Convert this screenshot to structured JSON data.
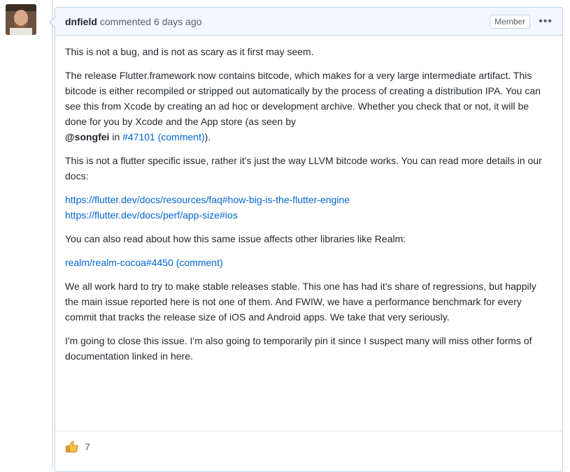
{
  "comment": {
    "author": "dnfield",
    "action": "commented",
    "time": "6 days ago",
    "badge": "Member",
    "menu_icon": "kebab-icon",
    "paragraphs": {
      "p1": "This is not a bug, and is not as scary as it first may seem.",
      "p2": "The release Flutter.framework now contains bitcode, which makes for a very large intermediate artifact. This bitcode is either recompiled or stripped out automatically by the process of creating a distribution IPA. You can see this from Xcode by creating an ad hoc or development archive. Whether you check that or not, it will be done for you by Xcode and the App store (as seen by",
      "p2_mention": "@songfei",
      "p2_in": " in ",
      "p2_link": "#47101 (comment)",
      "p2_end": ").",
      "p3": "This is not a flutter specific issue, rather it's just the way LLVM bitcode works. You can read more details in our docs:",
      "link1": "https://flutter.dev/docs/resources/faq#how-big-is-the-flutter-engine",
      "link2": "https://flutter.dev/docs/perf/app-size#ios",
      "p4": "You can also read about how this same issue affects other libraries like Realm:",
      "link3": "realm/realm-cocoa#4450 (comment)",
      "p5": "We all work hard to try to make stable releases stable. This one has had it's share of regressions, but happily the main issue reported here is not one of them. And FWIW, we have a performance benchmark for every commit that tracks the release size of iOS and Android apps. We take that very seriously.",
      "p6": "I'm going to close this issue. I'm also going to temporarily pin it since I suspect many will miss other forms of documentation linked in here."
    },
    "reaction": {
      "icon": "thumbs-up-icon",
      "count": "7"
    }
  }
}
